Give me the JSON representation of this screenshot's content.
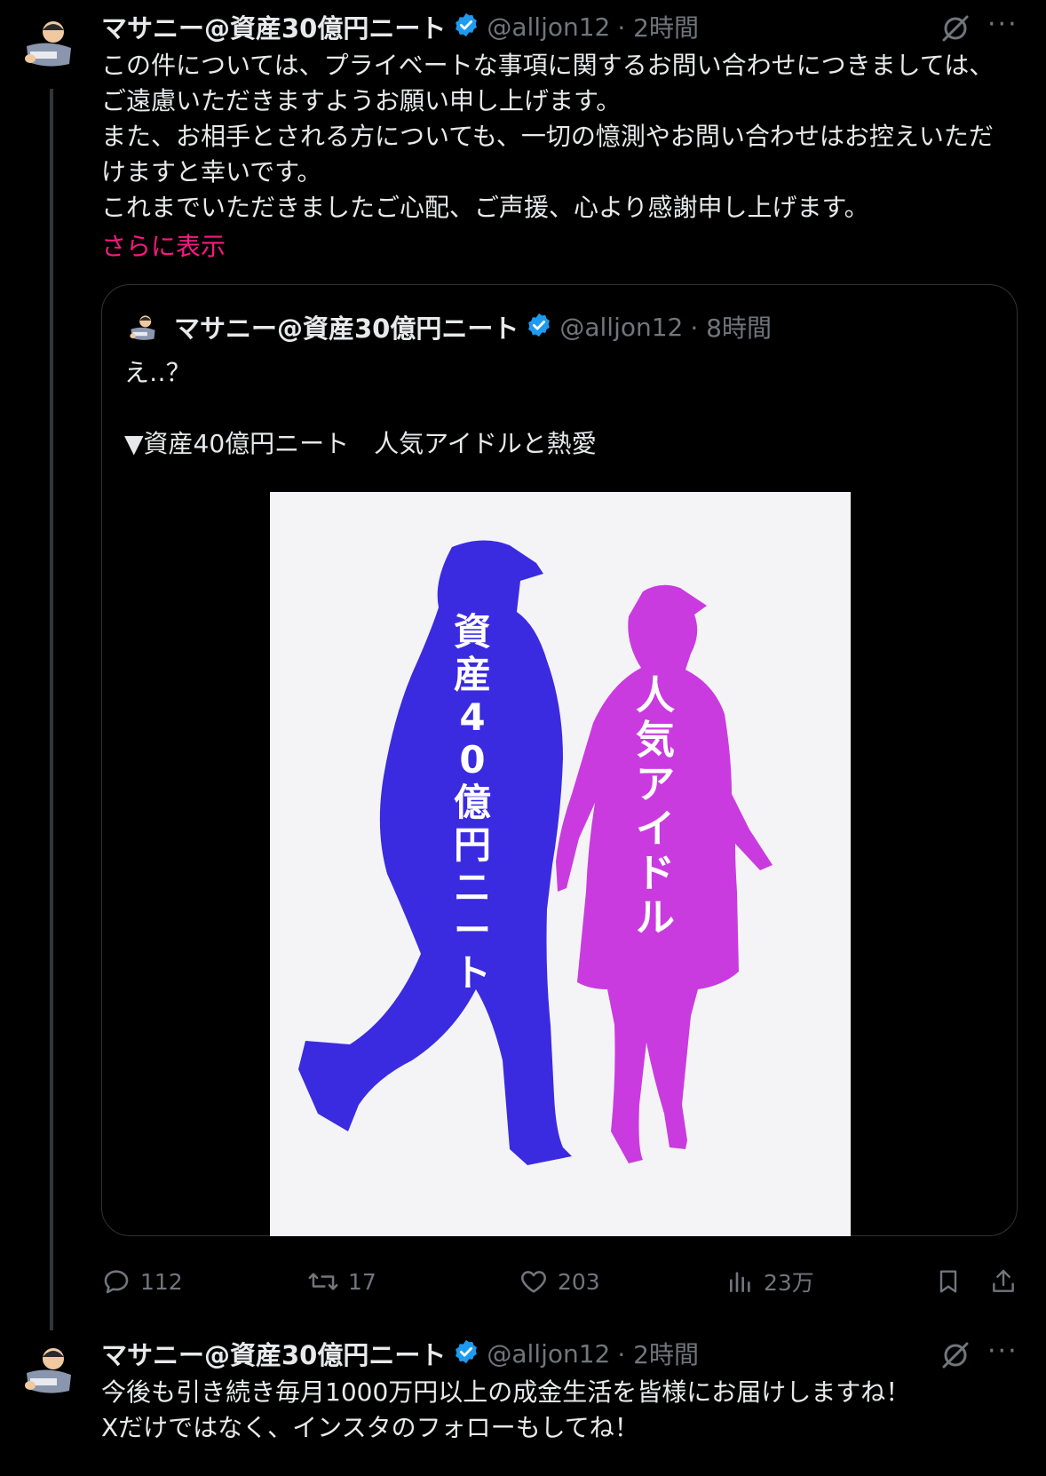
{
  "tweet1": {
    "name": "マサニー@資産30億円ニート",
    "handle": "@alljon12",
    "time": "· 2時間",
    "body": "この件については、プライベートな事項に関するお問い合わせにつきましては、ご遠慮いただきますようお願い申し上げます。\nまた、お相手とされる方についても、一切の憶測やお問い合わせはお控えいただけますと幸いです。\nこれまでいただきましたご心配、ご声援、心より感謝申し上げます。",
    "show_more": "さらに表示",
    "quote": {
      "name": "マサニー@資産30億円ニート",
      "handle": "@alljon12",
      "time": "· 8時間",
      "line1": "え‥？",
      "line2": "▼資産40億円ニート　人気アイドルと熱愛",
      "image_text_left": "資産40億円ニート",
      "image_text_right": "人気アイドル",
      "left_color": "#3a2be0",
      "right_color": "#c93bdf"
    },
    "actions": {
      "replies": "112",
      "retweets": "17",
      "likes": "203",
      "views": "23万"
    }
  },
  "tweet2": {
    "name": "マサニー@資産30億円ニート",
    "handle": "@alljon12",
    "time": "· 2時間",
    "body": "今後も引き続き毎月1000万円以上の成金生活を皆様にお届けしますね！\nXだけではなく、インスタのフォローもしてね！"
  },
  "colors": {
    "accent_blue": "#1d9bf0",
    "show_more_pink": "#f91880",
    "secondary_text": "#71767b"
  }
}
